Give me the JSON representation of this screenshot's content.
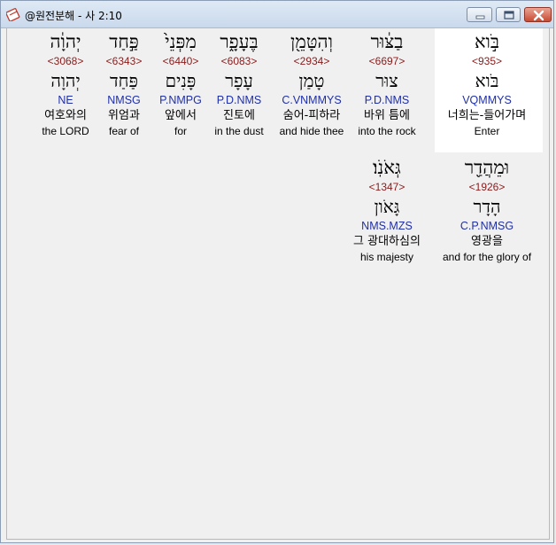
{
  "window": {
    "title": "@원전분해 - 사 2:10"
  },
  "rows": [
    [
      {
        "hebrew": "בֹּ֣וא",
        "strong": "<935>",
        "lexeme": "בֹּוא",
        "parse": "VQMMYS",
        "korean": "너희는-들어가며",
        "english": "Enter",
        "selected": true
      },
      {
        "hebrew": "בַצּ֔וּר",
        "strong": "<6697>",
        "lexeme": "צוּר",
        "parse": "P.D.NMS",
        "korean": "바위 틈에",
        "english": "into the rock"
      },
      {
        "hebrew": "וְהִטָּמֵ֖ן",
        "strong": "<2934>",
        "lexeme": "טָמַן",
        "parse": "C.VNMMYS",
        "korean": "숨어-피하라",
        "english": "and hide thee"
      },
      {
        "hebrew": "בֶּעָפָ֑ר",
        "strong": "<6083>",
        "lexeme": "עָפָר",
        "parse": "P.D.NMS",
        "korean": "진토에",
        "english": "in the dust"
      },
      {
        "hebrew": "מִפְּנֵי֙",
        "strong": "<6440>",
        "lexeme": "פָּנִים",
        "parse": "P.NMPG",
        "korean": "앞에서",
        "english": "for"
      },
      {
        "hebrew": "פַּ֣חַד",
        "strong": "<6343>",
        "lexeme": "פַּחַד",
        "parse": "NMSG",
        "korean": "위엄과",
        "english": "fear of"
      },
      {
        "hebrew": "יְהוָ֔ה",
        "strong": "<3068>",
        "lexeme": "יְהוָה",
        "parse": "NE",
        "korean": "여호와의",
        "english": "the LORD"
      }
    ],
    [
      {
        "hebrew": "וּמֵהֲדַ֖ר",
        "strong": "<1926>",
        "lexeme": "הָדָר",
        "parse": "C.P.NMSG",
        "korean": "영광을",
        "english": "and for the glory of"
      },
      {
        "hebrew": "גְּאֹנֹֽו׃",
        "strong": "<1347>",
        "lexeme": "גָּאֹון",
        "parse": "NMS.MZS",
        "korean": "그 광대하심의",
        "english": "his majesty"
      }
    ]
  ],
  "colors": {
    "strong": "#8b1a1a",
    "parse": "#1f2fa8",
    "selected_bg": "#ffffff"
  },
  "icons": {
    "app": "bible-app-icon",
    "minimize": "minimize-icon",
    "maximize": "maximize-icon",
    "close": "close-icon"
  }
}
